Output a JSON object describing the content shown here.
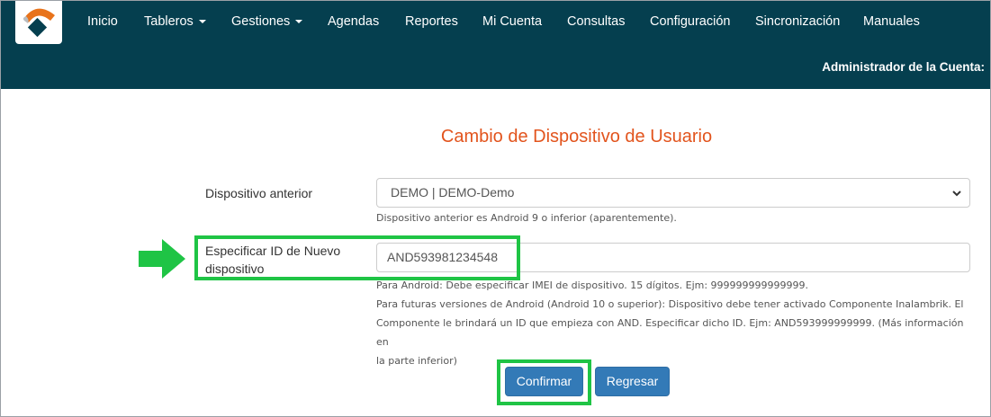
{
  "nav": {
    "items": [
      {
        "label": "Inicio",
        "dropdown": false
      },
      {
        "label": "Tableros",
        "dropdown": true
      },
      {
        "label": "Gestiones",
        "dropdown": true
      },
      {
        "label": "Agendas",
        "dropdown": false
      },
      {
        "label": "Reportes",
        "dropdown": false
      },
      {
        "label": "Mi Cuenta",
        "dropdown": false
      },
      {
        "label": "Consultas",
        "dropdown": false
      },
      {
        "label": "Configuración",
        "dropdown": false
      },
      {
        "label": "Sincronización",
        "dropdown": false
      },
      {
        "label": "Manuales",
        "dropdown": false
      }
    ],
    "admin_label": "Administrador de la Cuenta:"
  },
  "page": {
    "title": "Cambio de Dispositivo de Usuario"
  },
  "form": {
    "previous_device": {
      "label": "Dispositivo anterior",
      "value": "DEMO | DEMO-Demo",
      "help": "Dispositivo anterior es Android 9 o inferior (aparentemente)."
    },
    "new_device": {
      "label": "Especificar ID de Nuevo dispositivo",
      "value": "AND593981234548",
      "help_lines": [
        "Para Android: Debe especificar IMEI de dispositivo. 15 dígitos. Ejm: 999999999999999.",
        "Para futuras versiones de Android (Android 10 o superior): Dispositivo debe tener activado Componente Inalambrik. El",
        "Componente le brindará un ID que empieza con AND. Especificar dicho ID. Ejm: AND593999999999. (Más información en",
        "la parte inferior)"
      ]
    }
  },
  "buttons": {
    "confirm": "Confirmar",
    "back": "Regresar"
  },
  "colors": {
    "navbar": "#053f4f",
    "title": "#e2541d",
    "button": "#337ab7",
    "highlight": "#1fc445"
  },
  "icons": {
    "logo": "company-logo",
    "select_chevron": "chevron-down-icon",
    "annotation": "arrow-right-icon"
  }
}
